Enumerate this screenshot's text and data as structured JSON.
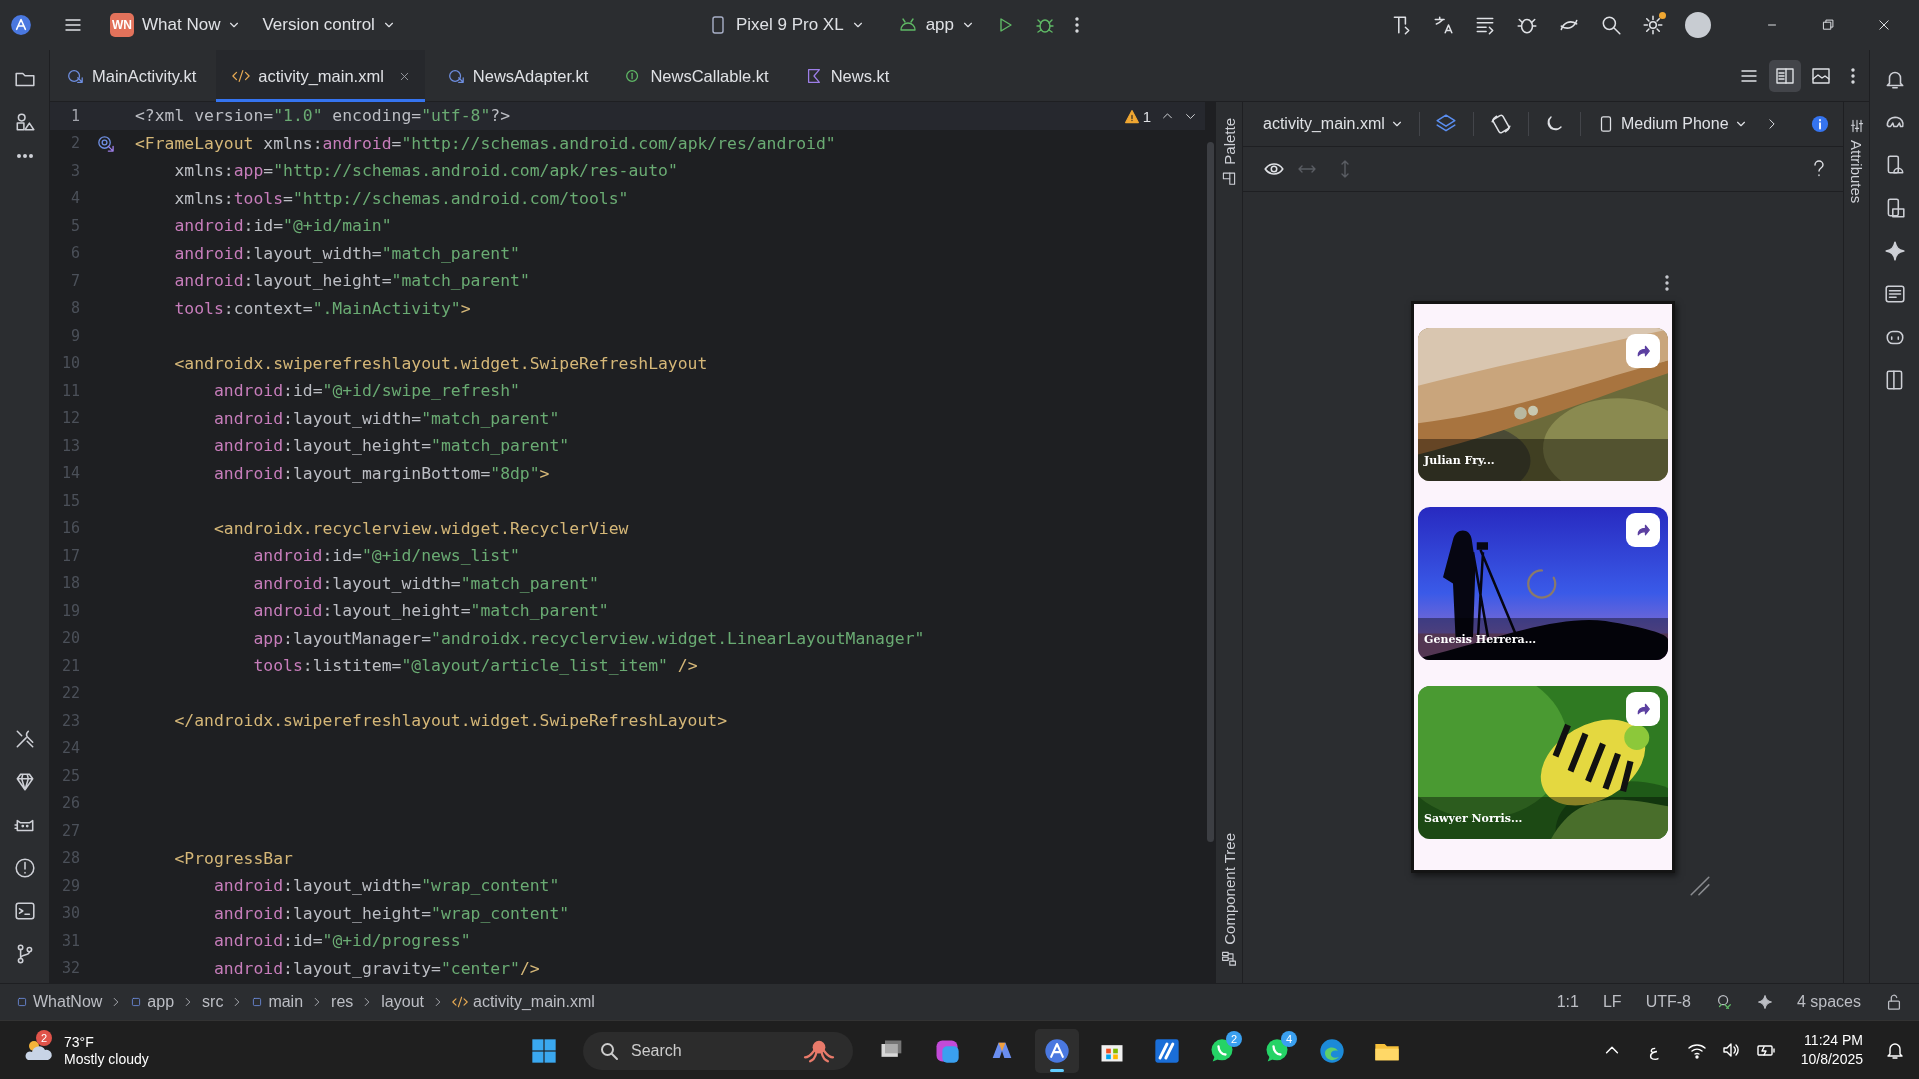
{
  "title_bar": {
    "project": {
      "initials": "WN",
      "name": "What Now"
    },
    "vcs": "Version control",
    "device": "Pixel 9 Pro XL",
    "run_config": "app"
  },
  "tabs": [
    {
      "label": "MainActivity.kt",
      "kind": "class",
      "selected": false
    },
    {
      "label": "activity_main.xml",
      "kind": "xml",
      "selected": true
    },
    {
      "label": "NewsAdapter.kt",
      "kind": "class",
      "selected": false
    },
    {
      "label": "NewsCallable.kt",
      "kind": "interface",
      "selected": false
    },
    {
      "label": "News.kt",
      "kind": "kotlin",
      "selected": false
    }
  ],
  "view_modes": [
    {
      "kind": "code",
      "selected": false
    },
    {
      "kind": "split",
      "selected": true
    },
    {
      "kind": "design",
      "selected": false
    }
  ],
  "editor": {
    "warnings": "1",
    "lines": [
      {
        "number": "1",
        "current": true,
        "tokens": [
          {
            "kind": "plain",
            "text": "<?xml version="
          },
          {
            "kind": "string",
            "text": "\"1.0\""
          },
          {
            "kind": "plain",
            "text": " encoding="
          },
          {
            "kind": "string",
            "text": "\"utf-8\""
          },
          {
            "kind": "plain",
            "text": "?>"
          }
        ]
      },
      {
        "number": "2",
        "current": false,
        "gutter_icon": true,
        "tokens": [
          {
            "kind": "tag",
            "text": "<FrameLayout"
          },
          {
            "kind": "plain",
            "text": " xmlns:"
          },
          {
            "kind": "ns",
            "text": "android"
          },
          {
            "kind": "plain",
            "text": "="
          },
          {
            "kind": "string",
            "text": "\"http://schemas.android.com/apk/res/android\""
          }
        ]
      },
      {
        "number": "3",
        "current": false,
        "tokens": [
          {
            "kind": "plain",
            "text": "    xmlns:"
          },
          {
            "kind": "ns",
            "text": "app"
          },
          {
            "kind": "plain",
            "text": "="
          },
          {
            "kind": "string",
            "text": "\"http://schemas.android.com/apk/res-auto\""
          }
        ]
      },
      {
        "number": "4",
        "current": false,
        "tokens": [
          {
            "kind": "plain",
            "text": "    xmlns:"
          },
          {
            "kind": "ns",
            "text": "tools"
          },
          {
            "kind": "plain",
            "text": "="
          },
          {
            "kind": "string",
            "text": "\"http://schemas.android.com/tools\""
          }
        ]
      },
      {
        "number": "5",
        "current": false,
        "tokens": [
          {
            "kind": "ns",
            "text": "    android"
          },
          {
            "kind": "plain",
            "text": ":id="
          },
          {
            "kind": "string",
            "text": "\"@+id/main\""
          }
        ]
      },
      {
        "number": "6",
        "current": false,
        "tokens": [
          {
            "kind": "ns",
            "text": "    android"
          },
          {
            "kind": "plain",
            "text": ":layout_width="
          },
          {
            "kind": "string",
            "text": "\"match_parent\""
          }
        ]
      },
      {
        "number": "7",
        "current": false,
        "tokens": [
          {
            "kind": "ns",
            "text": "    android"
          },
          {
            "kind": "plain",
            "text": ":layout_height="
          },
          {
            "kind": "string",
            "text": "\"match_parent\""
          }
        ]
      },
      {
        "number": "8",
        "current": false,
        "tokens": [
          {
            "kind": "ns",
            "text": "    tools"
          },
          {
            "kind": "plain",
            "text": ":context="
          },
          {
            "kind": "string",
            "text": "\".MainActivity\""
          },
          {
            "kind": "tag",
            "text": ">"
          }
        ]
      },
      {
        "number": "9",
        "current": false
      },
      {
        "number": "10",
        "current": false,
        "tokens": [
          {
            "kind": "tag",
            "text": "    <androidx.swiperefreshlayout.widget.SwipeRefreshLayout"
          }
        ]
      },
      {
        "number": "11",
        "current": false,
        "tokens": [
          {
            "kind": "ns",
            "text": "        android"
          },
          {
            "kind": "plain",
            "text": ":id="
          },
          {
            "kind": "string",
            "text": "\"@+id/swipe_refresh\""
          }
        ]
      },
      {
        "number": "12",
        "current": false,
        "tokens": [
          {
            "kind": "ns",
            "text": "        android"
          },
          {
            "kind": "plain",
            "text": ":layout_width="
          },
          {
            "kind": "string",
            "text": "\"match_parent\""
          }
        ]
      },
      {
        "number": "13",
        "current": false,
        "tokens": [
          {
            "kind": "ns",
            "text": "        android"
          },
          {
            "kind": "plain",
            "text": ":layout_height="
          },
          {
            "kind": "string",
            "text": "\"match_parent\""
          }
        ]
      },
      {
        "number": "14",
        "current": false,
        "tokens": [
          {
            "kind": "ns",
            "text": "        android"
          },
          {
            "kind": "plain",
            "text": ":layout_marginBottom="
          },
          {
            "kind": "string",
            "text": "\"8dp\""
          },
          {
            "kind": "tag",
            "text": ">"
          }
        ]
      },
      {
        "number": "15",
        "current": false
      },
      {
        "number": "16",
        "current": false,
        "tokens": [
          {
            "kind": "tag",
            "text": "        <androidx.recyclerview.widget.RecyclerView"
          }
        ]
      },
      {
        "number": "17",
        "current": false,
        "tokens": [
          {
            "kind": "ns",
            "text": "            android"
          },
          {
            "kind": "plain",
            "text": ":id="
          },
          {
            "kind": "string",
            "text": "\"@+id/news_list\""
          }
        ]
      },
      {
        "number": "18",
        "current": false,
        "tokens": [
          {
            "kind": "ns",
            "text": "            android"
          },
          {
            "kind": "plain",
            "text": ":layout_width="
          },
          {
            "kind": "string",
            "text": "\"match_parent\""
          }
        ]
      },
      {
        "number": "19",
        "current": false,
        "tokens": [
          {
            "kind": "ns",
            "text": "            android"
          },
          {
            "kind": "plain",
            "text": ":layout_height="
          },
          {
            "kind": "string",
            "text": "\"match_parent\""
          }
        ]
      },
      {
        "number": "20",
        "current": false,
        "tokens": [
          {
            "kind": "ns",
            "text": "            app"
          },
          {
            "kind": "plain",
            "text": ":layoutManager="
          },
          {
            "kind": "string",
            "text": "\"androidx.recyclerview.widget.LinearLayoutManager\""
          }
        ]
      },
      {
        "number": "21",
        "current": false,
        "tokens": [
          {
            "kind": "ns",
            "text": "            tools"
          },
          {
            "kind": "plain",
            "text": ":listitem="
          },
          {
            "kind": "string",
            "text": "\"@layout/article_list_item\""
          },
          {
            "kind": "tag",
            "text": " />"
          }
        ]
      },
      {
        "number": "22",
        "current": false
      },
      {
        "number": "23",
        "current": false,
        "tokens": [
          {
            "kind": "tag",
            "text": "    </androidx.swiperefreshlayout.widget.SwipeRefreshLayout>"
          }
        ]
      },
      {
        "number": "24",
        "current": false
      },
      {
        "number": "25",
        "current": false
      },
      {
        "number": "26",
        "current": false
      },
      {
        "number": "27",
        "current": false
      },
      {
        "number": "28",
        "current": false,
        "tokens": [
          {
            "kind": "tag",
            "text": "    <ProgressBar"
          }
        ]
      },
      {
        "number": "29",
        "current": false,
        "tokens": [
          {
            "kind": "ns",
            "text": "        android"
          },
          {
            "kind": "plain",
            "text": ":layout_width="
          },
          {
            "kind": "string",
            "text": "\"wrap_content\""
          }
        ]
      },
      {
        "number": "30",
        "current": false,
        "tokens": [
          {
            "kind": "ns",
            "text": "        android"
          },
          {
            "kind": "plain",
            "text": ":layout_height="
          },
          {
            "kind": "string",
            "text": "\"wrap_content\""
          }
        ]
      },
      {
        "number": "31",
        "current": false,
        "tokens": [
          {
            "kind": "ns",
            "text": "        android"
          },
          {
            "kind": "plain",
            "text": ":id="
          },
          {
            "kind": "string",
            "text": "\"@+id/progress\""
          }
        ]
      },
      {
        "number": "32",
        "current": false,
        "tokens": [
          {
            "kind": "ns",
            "text": "        android"
          },
          {
            "kind": "plain",
            "text": ":layout_gravity="
          },
          {
            "kind": "string",
            "text": "\"center\""
          },
          {
            "kind": "tag",
            "text": "/>"
          }
        ]
      }
    ]
  },
  "palette_label": "Palette",
  "component_tree_label": "Component Tree",
  "attributes_label": "Attributes",
  "design": {
    "file": "activity_main.xml",
    "device": "Medium Phone",
    "cards": [
      {
        "caption": "Julian Fry..."
      },
      {
        "caption": "Genesis Herrera..."
      },
      {
        "caption": "Sawyer Norris..."
      }
    ]
  },
  "status_bar": {
    "breadcrumbs": [
      {
        "label": "WhatNow",
        "kind": "module"
      },
      {
        "label": "app",
        "kind": "module"
      },
      {
        "label": "src",
        "kind": "folder"
      },
      {
        "label": "main",
        "kind": "module"
      },
      {
        "label": "res",
        "kind": "folder"
      },
      {
        "label": "layout",
        "kind": "folder"
      },
      {
        "label": "activity_main.xml",
        "kind": "xml"
      }
    ],
    "position": "1:1",
    "line_ending": "LF",
    "encoding": "UTF-8",
    "indent": "4 spaces"
  },
  "taskbar": {
    "weather": {
      "temperature": "73°F",
      "condition": "Mostly cloudy",
      "badge": "2"
    },
    "search_placeholder": "Search",
    "apps": [
      {
        "kind": "taskview"
      },
      {
        "kind": "m365"
      },
      {
        "kind": "copilot"
      },
      {
        "kind": "studio",
        "selected": true
      },
      {
        "kind": "store"
      },
      {
        "kind": "azure"
      },
      {
        "kind": "whatsapp",
        "badge": "2"
      },
      {
        "kind": "whatsapp",
        "badge": "4"
      },
      {
        "kind": "edge"
      },
      {
        "kind": "files"
      }
    ],
    "language": "ع",
    "time": "11:24 PM",
    "date": "10/8/2025"
  }
}
